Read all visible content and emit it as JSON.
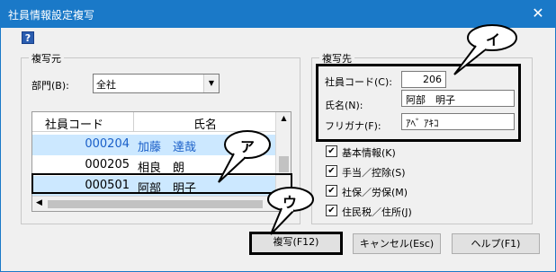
{
  "window": {
    "title": "社員情報設定複写",
    "close_glyph": "✕"
  },
  "help_glyph": "?",
  "source": {
    "label": "複写元",
    "dept_label": "部門(B):",
    "dept_value": "全社",
    "grid": {
      "headers": {
        "code": "社員コード",
        "name": "氏名"
      },
      "rows": [
        {
          "code": "000204",
          "name": "加藤　達哉"
        },
        {
          "code": "000205",
          "name": "相良　朗"
        },
        {
          "code": "000501",
          "name": "阿部　明子"
        }
      ]
    }
  },
  "dest": {
    "label": "複写先",
    "code_label": "社員コード(C):",
    "code_value": "206",
    "name_label": "氏名(N):",
    "name_value": "阿部　明子",
    "kana_label": "フリガナ(F):",
    "kana_value": "ｱﾍﾞ ｱｷｺ"
  },
  "options": [
    {
      "label": "基本情報(K)",
      "checked": true
    },
    {
      "label": "手当／控除(S)",
      "checked": true
    },
    {
      "label": "社保／労保(M)",
      "checked": true
    },
    {
      "label": "住民税／住所(J)",
      "checked": true
    }
  ],
  "check_glyph": "✔",
  "buttons": {
    "copy": "複写(F12)",
    "cancel": "キャンセル(Esc)",
    "help": "ヘルプ(F1)"
  },
  "callouts": {
    "a": "ア",
    "i": "イ",
    "u": "ウ"
  },
  "colors": {
    "titlebar": "#1a79c8",
    "selected_row": "#cce8ff",
    "link_text": "#1a5fc8"
  }
}
